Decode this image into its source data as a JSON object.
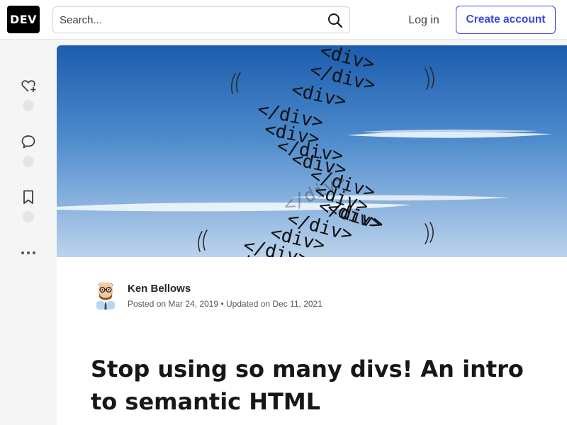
{
  "header": {
    "logo_text": "DEV",
    "search": {
      "placeholder": "Search..."
    },
    "login_label": "Log in",
    "create_account_label": "Create account",
    "accent_color": "#3b49df"
  },
  "sidebar": {
    "actions": [
      {
        "name": "heart-plus-icon"
      },
      {
        "name": "comment-icon"
      },
      {
        "name": "bookmark-icon"
      },
      {
        "name": "more-options-icon"
      }
    ]
  },
  "article": {
    "cover": {
      "div_tags": [
        "<div>",
        "</div>",
        "<div>",
        "</div>",
        "<div>",
        "</div>",
        "<div>",
        "</div>",
        "<div>",
        "</div>",
        "<div>",
        "</div>",
        "<div>",
        "</div>",
        "<div>",
        "</div>",
        "<div>",
        "</div>"
      ]
    },
    "author": {
      "name": "Ken Bellows",
      "posted_prefix": "Posted on",
      "posted_date": "Mar 24, 2019",
      "updated_prefix": "Updated on",
      "updated_date": "Dec 11, 2021"
    },
    "title": "Stop using so many divs! An intro to semantic HTML"
  }
}
